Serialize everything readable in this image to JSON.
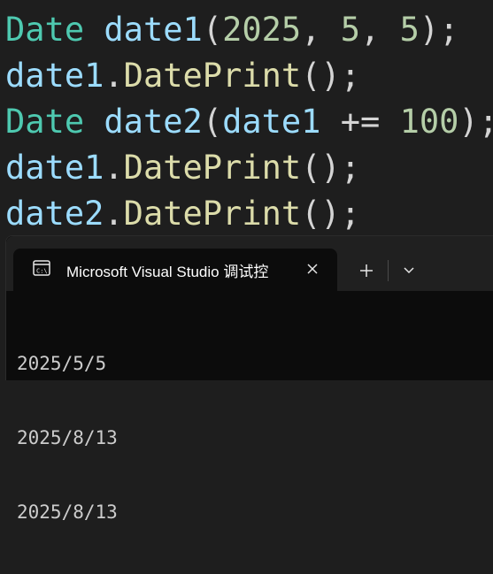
{
  "editor": {
    "lines": [
      [
        {
          "t": "type",
          "v": "Date"
        },
        {
          "t": "punc",
          "v": " "
        },
        {
          "t": "var",
          "v": "date1"
        },
        {
          "t": "punc",
          "v": "("
        },
        {
          "t": "num",
          "v": "2025"
        },
        {
          "t": "punc",
          "v": ", "
        },
        {
          "t": "num",
          "v": "5"
        },
        {
          "t": "punc",
          "v": ", "
        },
        {
          "t": "num",
          "v": "5"
        },
        {
          "t": "punc",
          "v": ");"
        }
      ],
      [
        {
          "t": "var",
          "v": "date1"
        },
        {
          "t": "punc",
          "v": "."
        },
        {
          "t": "func",
          "v": "DatePrint"
        },
        {
          "t": "punc",
          "v": "();"
        }
      ],
      [
        {
          "t": "type",
          "v": "Date"
        },
        {
          "t": "punc",
          "v": " "
        },
        {
          "t": "var",
          "v": "date2"
        },
        {
          "t": "punc",
          "v": "("
        },
        {
          "t": "var",
          "v": "date1"
        },
        {
          "t": "op",
          "v": " += "
        },
        {
          "t": "num",
          "v": "100"
        },
        {
          "t": "punc",
          "v": ");"
        }
      ],
      [
        {
          "t": "var",
          "v": "date1"
        },
        {
          "t": "punc",
          "v": "."
        },
        {
          "t": "func",
          "v": "DatePrint"
        },
        {
          "t": "punc",
          "v": "();"
        }
      ],
      [
        {
          "t": "var",
          "v": "date2"
        },
        {
          "t": "punc",
          "v": "."
        },
        {
          "t": "func",
          "v": "DatePrint"
        },
        {
          "t": "punc",
          "v": "();"
        }
      ]
    ]
  },
  "terminal": {
    "tab_title": "Microsoft Visual Studio 调试控",
    "tab_icon": "console-icon",
    "close_icon": "close-icon",
    "new_tab_icon": "plus-icon",
    "dropdown_icon": "chevron-down-icon",
    "output": [
      "2025/5/5",
      "2025/8/13",
      "2025/8/13"
    ]
  },
  "colors": {
    "type": "#4ec9b0",
    "variable": "#9cdcfe",
    "function": "#dcdcaa",
    "number": "#b5cea8",
    "punctuation": "#d4d4d4",
    "editor_bg": "#1e1e1e",
    "terminal_bg": "#0c0c0c",
    "tabbar_bg": "#202020"
  }
}
